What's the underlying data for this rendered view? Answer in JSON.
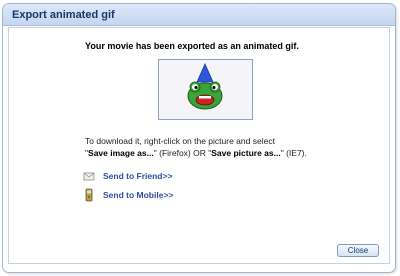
{
  "dialog": {
    "title": "Export animated gif",
    "message": "Your movie has been exported as an animated gif.",
    "instructions": {
      "line1": "To download it, right-click on the picture and select",
      "q1_open": "\"",
      "option1": "Save image as...",
      "q1_close": "\"",
      "mid": " (Firefox) OR \"",
      "option2": "Save picture as...",
      "end": "\" (IE7)."
    },
    "links": {
      "friend": "Send to Friend>>",
      "mobile": "Send to Mobile>>"
    },
    "close_label": "Close"
  },
  "icons": {
    "preview_character": "green-frog-party-hat",
    "friend": "envelope-icon",
    "mobile": "mobile-phone-icon"
  },
  "colors": {
    "title_text": "#15386d",
    "link": "#2b4f9e",
    "frog_green": "#3aa33a",
    "hat_blue": "#2b57d8",
    "mouth_red": "#cc2222"
  }
}
